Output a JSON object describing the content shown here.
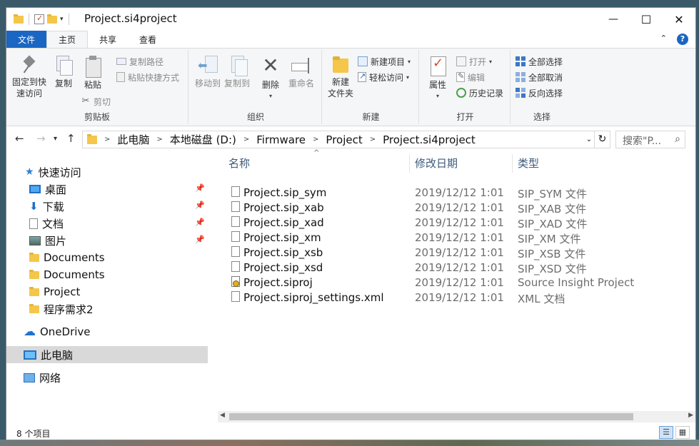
{
  "window": {
    "title": "Project.si4project"
  },
  "window_controls": {
    "minimize": "—",
    "maximize": "☐",
    "close": "✕"
  },
  "tabs": [
    {
      "label": "文件"
    },
    {
      "label": "主页"
    },
    {
      "label": "共享"
    },
    {
      "label": "查看"
    }
  ],
  "ribbon": {
    "clipboard": {
      "group": "剪贴板",
      "pin_line1": "固定到快",
      "pin_line2": "速访问",
      "copy": "复制",
      "paste": "粘贴",
      "copy_path": "复制路径",
      "paste_shortcut": "粘贴快捷方式",
      "cut": "剪切"
    },
    "organize": {
      "group": "组织",
      "move_to": "移动到",
      "copy_to": "复制到",
      "delete": "删除",
      "rename": "重命名"
    },
    "new": {
      "group": "新建",
      "new_folder_line1": "新建",
      "new_folder_line2": "文件夹",
      "new_item": "新建项目",
      "easy_access": "轻松访问"
    },
    "open": {
      "group": "打开",
      "properties": "属性",
      "open": "打开",
      "edit": "编辑",
      "history": "历史记录"
    },
    "select": {
      "group": "选择",
      "select_all": "全部选择",
      "select_none": "全部取消",
      "invert": "反向选择"
    }
  },
  "address": {
    "crumbs": [
      "此电脑",
      "本地磁盘 (D:)",
      "Firmware",
      "Project",
      "Project.si4project"
    ],
    "search_placeholder": "搜索\"P..."
  },
  "navpane": {
    "quick_access": "快速访问",
    "items": [
      {
        "label": "桌面"
      },
      {
        "label": "下载"
      },
      {
        "label": "文档"
      },
      {
        "label": "图片"
      },
      {
        "label": "Documents"
      },
      {
        "label": "Documents"
      },
      {
        "label": "Project"
      },
      {
        "label": "程序需求2"
      }
    ],
    "onedrive": "OneDrive",
    "this_pc": "此电脑",
    "network": "网络"
  },
  "columns": {
    "name": "名称",
    "date": "修改日期",
    "type": "类型"
  },
  "files": [
    {
      "name": "Project.sip_sym",
      "date": "2019/12/12 1:01",
      "type": "SIP_SYM 文件"
    },
    {
      "name": "Project.sip_xab",
      "date": "2019/12/12 1:01",
      "type": "SIP_XAB 文件"
    },
    {
      "name": "Project.sip_xad",
      "date": "2019/12/12 1:01",
      "type": "SIP_XAD 文件"
    },
    {
      "name": "Project.sip_xm",
      "date": "2019/12/12 1:01",
      "type": "SIP_XM 文件"
    },
    {
      "name": "Project.sip_xsb",
      "date": "2019/12/12 1:01",
      "type": "SIP_XSB 文件"
    },
    {
      "name": "Project.sip_xsd",
      "date": "2019/12/12 1:01",
      "type": "SIP_XSD 文件"
    },
    {
      "name": "Project.siproj",
      "date": "2019/12/12 1:01",
      "type": "Source Insight Project"
    },
    {
      "name": "Project.siproj_settings.xml",
      "date": "2019/12/12 1:01",
      "type": "XML 文档"
    }
  ],
  "status": {
    "item_count": "8 个项目"
  },
  "colors": {
    "accent": "#1a66c2",
    "header_text": "#3c5a7a",
    "selected_bg": "#d9d9d9"
  }
}
